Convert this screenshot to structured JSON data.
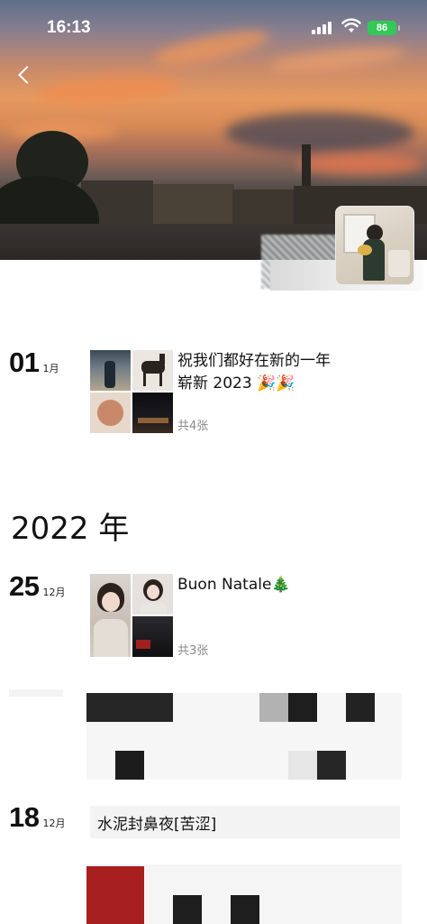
{
  "status_bar": {
    "time": "16:13",
    "battery": "86"
  },
  "colors": {
    "battery": "#34c759",
    "accent": "#111111",
    "muted": "#888888"
  },
  "icons": {
    "back": "chevron-left-icon",
    "signal": "cellular-signal-icon",
    "wifi": "wifi-icon",
    "battery": "battery-icon"
  },
  "timeline": {
    "posts": [
      {
        "day": "01",
        "month": "1月",
        "text_line1": "祝我们都好在新的一年",
        "text_line2": "崭新 2023 🎉🎉",
        "count": "共4张"
      },
      {
        "day": "25",
        "month": "12月",
        "text_line1": "Buon Natale🎄",
        "count": "共3张"
      },
      {
        "day": "18",
        "month": "12月",
        "text_line1": "水泥封鼻夜[苦涩]"
      }
    ],
    "year_header": "2022 年"
  }
}
